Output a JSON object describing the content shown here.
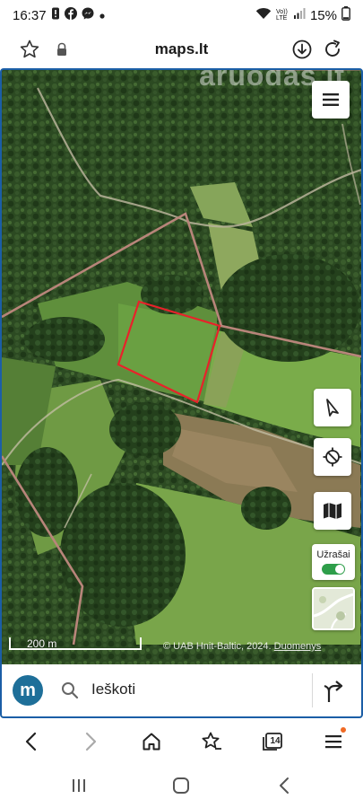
{
  "status_bar": {
    "time": "16:37",
    "network_label": "Vo)) LTE",
    "battery": "15%",
    "icons": [
      "alert-icon",
      "facebook-icon",
      "messenger-icon",
      "dot-icon",
      "wifi-icon",
      "signal-icon",
      "battery-icon"
    ]
  },
  "address_bar": {
    "url": "maps.lt",
    "icons": [
      "star-icon",
      "lock-icon",
      "download-icon",
      "reload-icon"
    ]
  },
  "map": {
    "watermark": "aruodas.lt",
    "scale_label": "200 m",
    "attribution": "© UAB Hnit-Baltic, 2024.",
    "attribution_link": "Duomenys",
    "notes_label": "Užrašai",
    "notes_enabled": true,
    "colors": {
      "parcel_outline": "#e8222a",
      "boundary_lines": "#b8857a",
      "toggle_on": "#2e9e4a"
    }
  },
  "search": {
    "logo_letter": "m",
    "placeholder": "Ieškoti",
    "logo_color": "#1e6f99"
  },
  "browser_nav": {
    "tab_count": "14",
    "items": [
      "back-icon",
      "forward-icon",
      "home-icon",
      "bookmarks-icon",
      "tabs-icon",
      "menu-icon"
    ]
  },
  "system_nav": {
    "items": [
      "recents-icon",
      "home-icon",
      "back-icon"
    ]
  }
}
